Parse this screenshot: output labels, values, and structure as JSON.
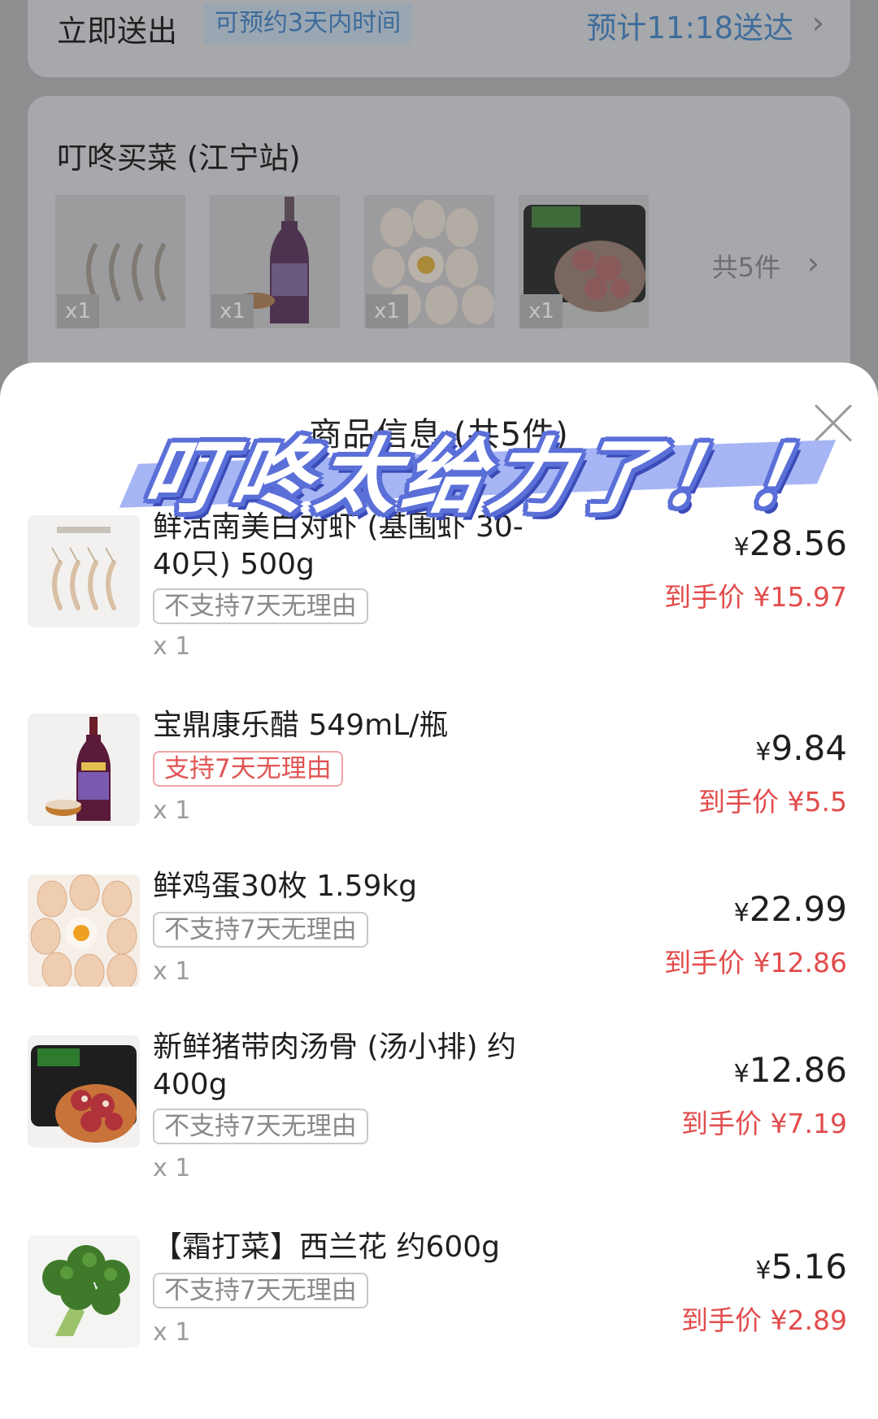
{
  "delivery": {
    "title": "立即送出",
    "tag": "可预约3天内时间",
    "eta": "预计11:18送达",
    "chevron": "›"
  },
  "store": {
    "name": "叮咚买菜 (江宁站)",
    "thumbnails": [
      {
        "icon": "shrimp-icon",
        "qty": "x1"
      },
      {
        "icon": "vinegar-bottle-icon",
        "qty": "x1"
      },
      {
        "icon": "eggs-icon",
        "qty": "x1"
      },
      {
        "icon": "pork-ribs-icon",
        "qty": "x1"
      }
    ],
    "count": "共5件",
    "chevron": "›"
  },
  "sheet": {
    "title": "商品信息 (共5件)",
    "sticker": "叮咚太给力了！！"
  },
  "items": [
    {
      "name": "鲜活南美白对虾 (基围虾 30-40只) 500g",
      "tag": "不支持7天无理由",
      "qty": "x 1",
      "price": "28.56",
      "currency": "¥",
      "final": "到手价 ¥15.97",
      "icon": "shrimp-icon"
    },
    {
      "name": "宝鼎康乐醋 549mL/瓶",
      "tag": "支持7天无理由",
      "qty": "x 1",
      "price": "9.84",
      "currency": "¥",
      "final": "到手价 ¥5.5",
      "icon": "vinegar-bottle-icon"
    },
    {
      "name": "鲜鸡蛋30枚 1.59kg",
      "tag": "不支持7天无理由",
      "qty": "x 1",
      "price": "22.99",
      "currency": "¥",
      "final": "到手价 ¥12.86",
      "icon": "eggs-icon"
    },
    {
      "name": "新鲜猪带肉汤骨 (汤小排) 约 400g",
      "tag": "不支持7天无理由",
      "qty": "x 1",
      "price": "12.86",
      "currency": "¥",
      "final": "到手价 ¥7.19",
      "icon": "pork-ribs-icon"
    },
    {
      "name": "【霜打菜】西兰花 约600g",
      "tag": "不支持7天无理由",
      "qty": "x 1",
      "price": "5.16",
      "currency": "¥",
      "final": "到手价 ¥2.89",
      "icon": "broccoli-icon"
    }
  ],
  "colors": {
    "accent_blue": "#3e6d9c",
    "price_red": "#e24c4c",
    "sticker_blue": "#5b6fd8"
  }
}
